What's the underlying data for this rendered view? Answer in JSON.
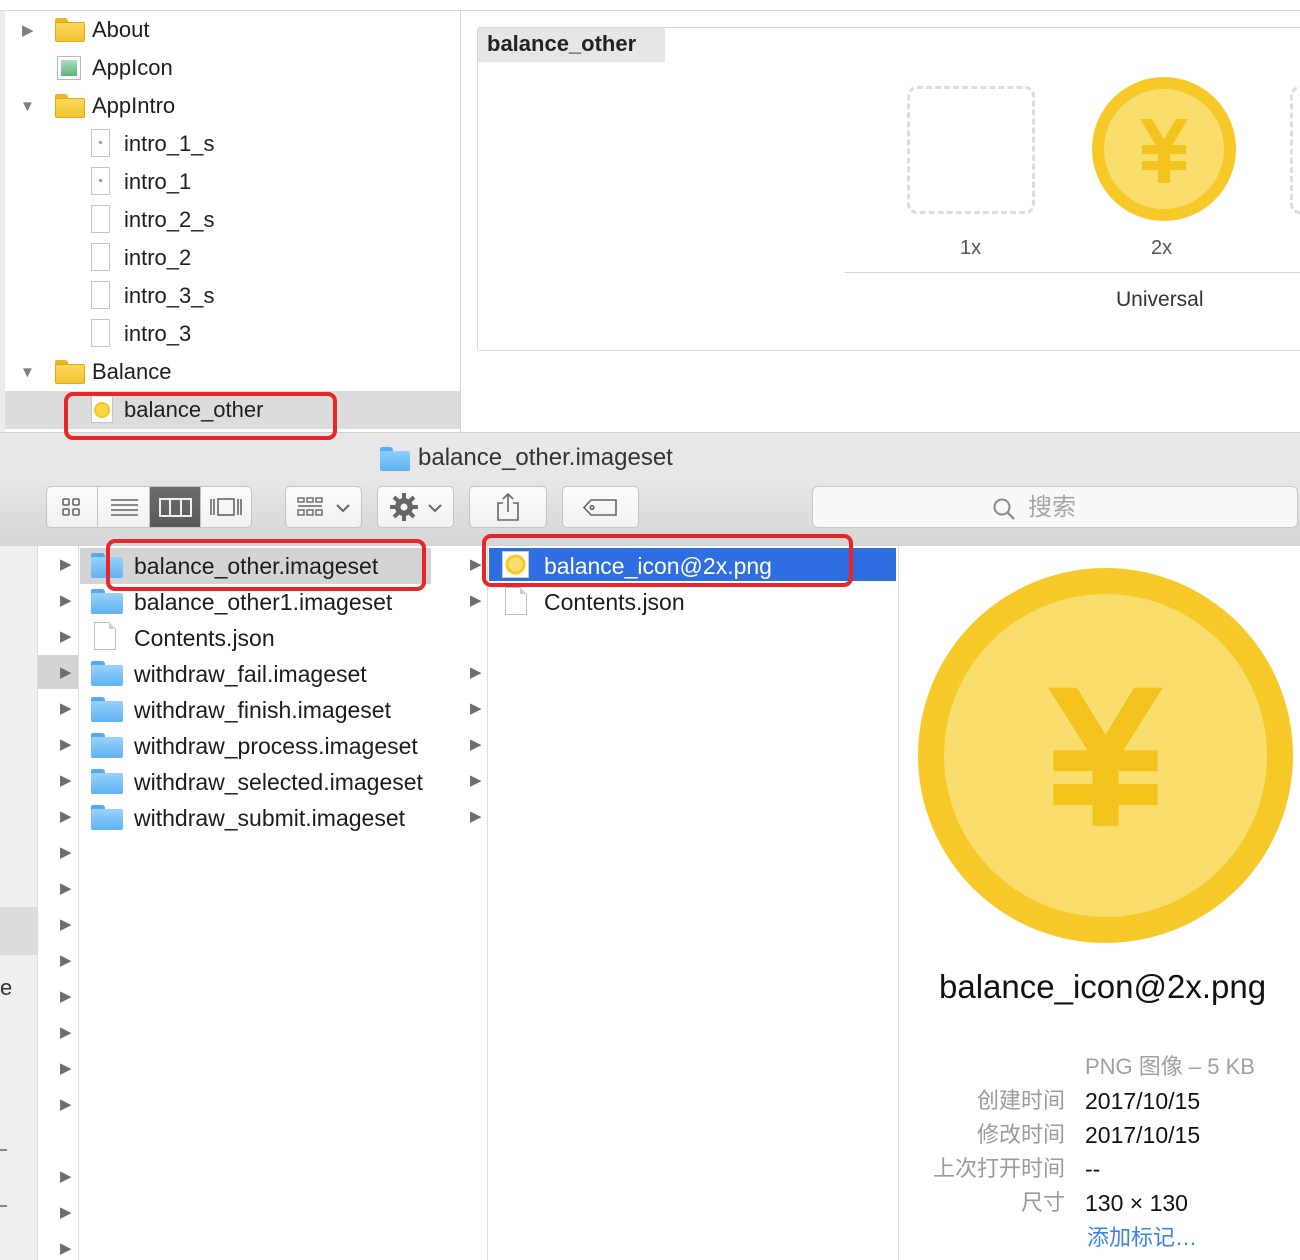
{
  "xcode": {
    "navigator": [
      {
        "label": "About",
        "icon": "folder-icon",
        "expand": "collapsed"
      },
      {
        "label": "AppIcon",
        "icon": "appicon-icon",
        "expand": "none"
      },
      {
        "label": "AppIntro",
        "icon": "folder-icon",
        "expand": "expanded"
      },
      {
        "label": "intro_1_s",
        "icon": "image-file-icon",
        "expand": "none"
      },
      {
        "label": "intro_1",
        "icon": "image-file-icon",
        "expand": "none"
      },
      {
        "label": "intro_2_s",
        "icon": "image-file-icon",
        "expand": "none"
      },
      {
        "label": "intro_2",
        "icon": "image-file-icon",
        "expand": "none"
      },
      {
        "label": "intro_3_s",
        "icon": "image-file-icon",
        "expand": "none"
      },
      {
        "label": "intro_3",
        "icon": "image-file-icon",
        "expand": "none"
      },
      {
        "label": "Balance",
        "icon": "folder-icon",
        "expand": "expanded"
      },
      {
        "label": "balance_other",
        "icon": "coin-image-icon",
        "expand": "none",
        "selected": true
      }
    ],
    "editor": {
      "asset_name": "balance_other",
      "slots": [
        "1x",
        "2x"
      ],
      "device": "Universal"
    }
  },
  "finder": {
    "window_title": "balance_other.imageset",
    "search_placeholder": "搜索",
    "toolbar_icons": [
      "icon-view-icon",
      "list-view-icon",
      "column-view-icon",
      "gallery-view-icon",
      "group-menu-icon",
      "gear-icon",
      "share-icon",
      "tag-icon"
    ],
    "column1": [
      {
        "name": "balance_other.imageset",
        "type": "folder",
        "selected": true
      },
      {
        "name": "balance_other1.imageset",
        "type": "folder"
      },
      {
        "name": "Contents.json",
        "type": "file"
      },
      {
        "name": "withdraw_fail.imageset",
        "type": "folder"
      },
      {
        "name": "withdraw_finish.imageset",
        "type": "folder"
      },
      {
        "name": "withdraw_process.imageset",
        "type": "folder"
      },
      {
        "name": "withdraw_selected.imageset",
        "type": "folder"
      },
      {
        "name": "withdraw_submit.imageset",
        "type": "folder"
      }
    ],
    "column2": [
      {
        "name": "balance_icon@2x.png",
        "type": "png",
        "selected": true
      },
      {
        "name": "Contents.json",
        "type": "file"
      }
    ],
    "preview": {
      "filename": "balance_icon@2x.png",
      "kind": "PNG 图像 – 5 KB",
      "meta": [
        {
          "key": "创建时间",
          "value": "2017/10/15"
        },
        {
          "key": "修改时间",
          "value": "2017/10/15"
        },
        {
          "key": "上次打开时间",
          "value": "--"
        },
        {
          "key": "尺寸",
          "value": "130 × 130"
        }
      ],
      "add_tags": "添加标记…"
    },
    "colors": {
      "selection_blue": "#2e6ee0",
      "highlight_red": "#e8262a",
      "coin_outer": "#f7c928",
      "coin_inner": "#f9de6d"
    }
  }
}
